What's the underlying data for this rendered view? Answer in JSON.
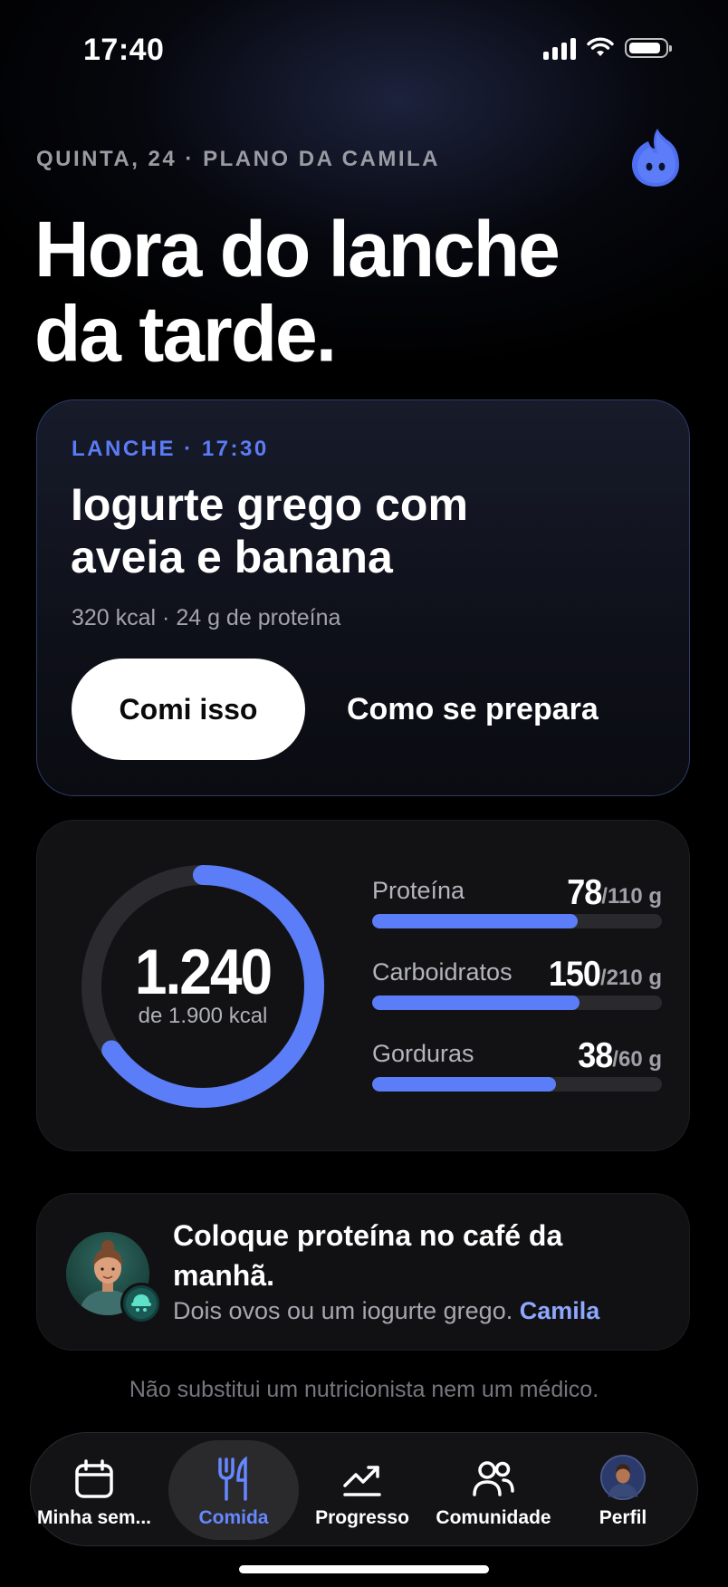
{
  "status_bar": {
    "time": "17:40",
    "battery_level": 0.92
  },
  "header": {
    "eyebrow": "QUINTA, 24 · PLANO DA CAMILA",
    "headline": "Hora do lanche\nda tarde.",
    "mascot_icon": "blue-flame-mascot-icon"
  },
  "meal": {
    "tag": "LANCHE · 17:30",
    "title": "Iogurte grego com\naveia e banana",
    "meta": "320 kcal · 24 g de proteína",
    "primary_label": "Comi isso",
    "secondary_label": "Como se prepara"
  },
  "calories": {
    "consumed": 1240,
    "consumed_label": "1.240",
    "goal": 1900,
    "goal_label": "de 1.900 kcal",
    "ring_color": "#5b7ef8"
  },
  "macros": [
    {
      "name": "Proteína",
      "value": "78",
      "goal_label": "/110 g",
      "current": 78,
      "goal": 110
    },
    {
      "name": "Carboidratos",
      "value": "150",
      "goal_label": "/210 g",
      "current": 150,
      "goal": 210
    },
    {
      "name": "Gorduras",
      "value": "38",
      "goal_label": "/60 g",
      "current": 38,
      "goal": 60
    }
  ],
  "tip": {
    "title": "Coloque proteína no café da\nmanhã.",
    "text": "Dois ovos ou um iogurte grego.",
    "author": "Camila"
  },
  "disclaimer": "Não substitui um nutricionista nem um médico.",
  "tabs": [
    {
      "label": "Minha sem...",
      "icon": "calendar-icon",
      "active": false
    },
    {
      "label": "Comida",
      "icon": "fork-knife-icon",
      "active": true
    },
    {
      "label": "Progresso",
      "icon": "trend-up-icon",
      "active": false
    },
    {
      "label": "Comunidade",
      "icon": "people-icon",
      "active": false
    },
    {
      "label": "Perfil",
      "icon": "profile-avatar",
      "active": false
    }
  ],
  "colors": {
    "accent": "#5b7ef8",
    "tag_blue": "#5b7cf7",
    "link": "#8ea7ff",
    "background": "#000000"
  }
}
